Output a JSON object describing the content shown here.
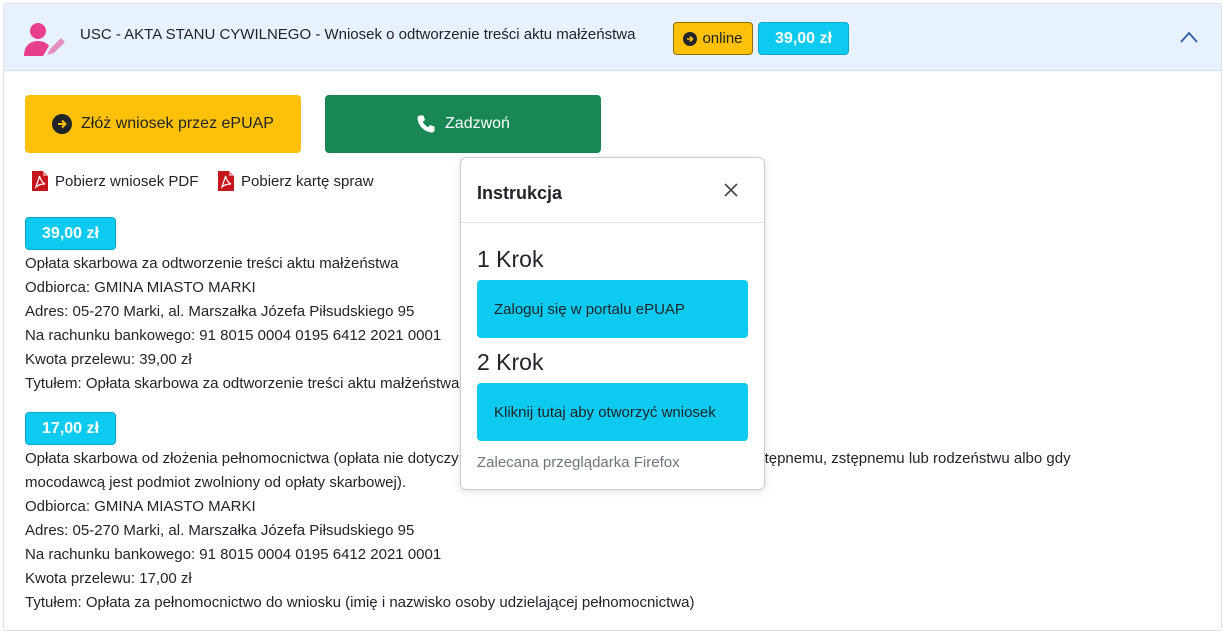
{
  "header": {
    "title": "USC - AKTA STANU CYWILNEGO - Wniosek o odtworzenie treści aktu małżeństwa",
    "online_label": "online",
    "price": "39,00 zł"
  },
  "actions": {
    "epuap_label": "Złóż wniosek przez ePUAP",
    "call_label": "Zadzwoń"
  },
  "links": {
    "pdf_label": "Pobierz wniosek PDF",
    "card_label": "Pobierz kartę spraw"
  },
  "fees": [
    {
      "price": "39,00 zł",
      "lines": [
        "Opłata skarbowa za odtworzenie treści aktu małżeństwa",
        "Odbiorca: GMINA MIASTO MARKI",
        "Adres: 05-270 Marki, al. Marszałka Józefa Piłsudskiego 95",
        "Na rachunku bankowego: 91 8015 0004 0195 6412 2021 0001",
        "Kwota przelewu: 39,00 zł",
        "Tytułem: Opłata skarbowa za odtworzenie treści aktu małżeństwa"
      ]
    },
    {
      "price": "17,00 zł",
      "lines": [
        "Opłata skarbowa od złożenia pełnomocnictwa (opłata nie dotyczy pełnomocnictwa udzielanego małżonkowi, wstępnemu, zstępnemu lub rodzeństwu albo gdy",
        "mocodawcą jest podmiot zwolniony od opłaty skarbowej).",
        "Odbiorca: GMINA MIASTO MARKI",
        "Adres: 05-270 Marki, al. Marszałka Józefa Piłsudskiego 95",
        "Na rachunku bankowego: 91 8015 0004 0195 6412 2021 0001",
        "Kwota przelewu: 17,00 zł",
        "Tytułem: Opłata za pełnomocnictwo do wniosku (imię i nazwisko osoby udzielającej pełnomocnictwa)"
      ]
    }
  ],
  "popover": {
    "title": "Instrukcja",
    "step1_title": "1 Krok",
    "step1_button": "Zaloguj się w portalu ePUAP",
    "step2_title": "2 Krok",
    "step2_button": "Kliknij tutaj aby otworzyć wniosek",
    "browser_note": "Zalecana przeglądarka Firefox"
  },
  "colors": {
    "header_bg": "#e7f1ff",
    "warning": "#ffc107",
    "info": "#0dcaf0",
    "success": "#198754",
    "pdf_red": "#c4161c",
    "user_icon": "#e83e8c"
  },
  "icons": [
    "user-edit-icon",
    "arrow-circle-right-icon",
    "phone-icon",
    "chevron-up-icon",
    "pdf-file-icon",
    "close-icon"
  ]
}
